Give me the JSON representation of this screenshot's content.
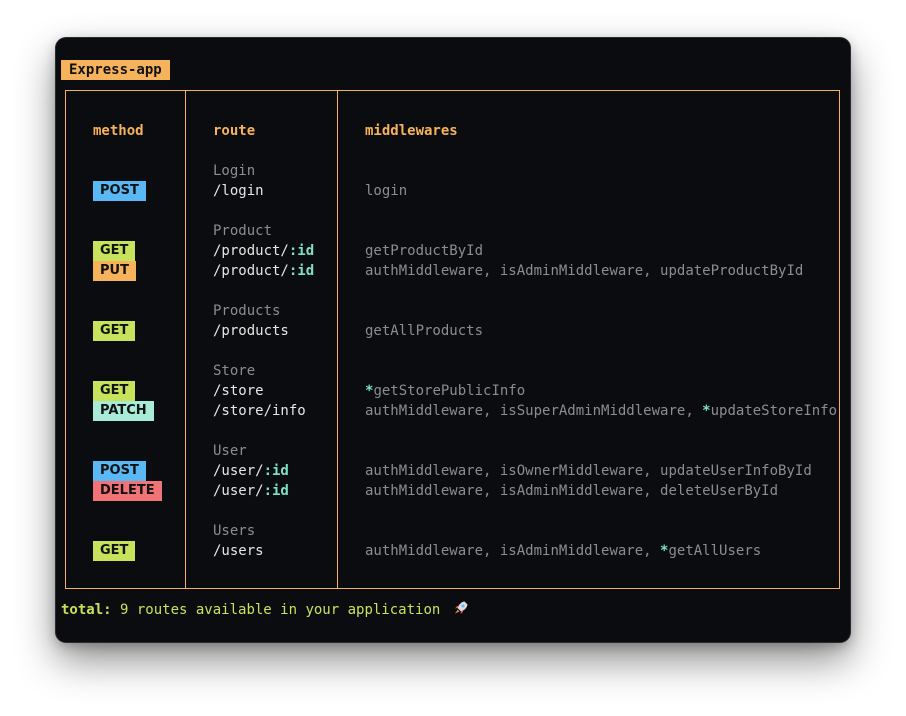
{
  "app": {
    "name": "Express-app",
    "badge_color": "#f6b35c"
  },
  "headers": {
    "method": "method",
    "route": "route",
    "middlewares": "middlewares"
  },
  "method_colors": {
    "GET": "#c7e35b",
    "POST": "#5ab8f5",
    "PUT": "#f6b35c",
    "PATCH": "#a8ecd8",
    "DELETE": "#f07378"
  },
  "groups": [
    {
      "name": "Login",
      "routes": [
        {
          "method": "POST",
          "path": "/login",
          "param": "",
          "middlewares": [
            {
              "name": "login",
              "star": false
            }
          ]
        }
      ]
    },
    {
      "name": "Product",
      "routes": [
        {
          "method": "GET",
          "path": "/product/",
          "param": ":id",
          "middlewares": [
            {
              "name": "getProductById",
              "star": false
            }
          ]
        },
        {
          "method": "PUT",
          "path": "/product/",
          "param": ":id",
          "middlewares": [
            {
              "name": "authMiddleware",
              "star": false
            },
            {
              "name": "isAdminMiddleware",
              "star": false
            },
            {
              "name": "updateProductById",
              "star": false
            }
          ]
        }
      ]
    },
    {
      "name": "Products",
      "routes": [
        {
          "method": "GET",
          "path": "/products",
          "param": "",
          "middlewares": [
            {
              "name": "getAllProducts",
              "star": false
            }
          ]
        }
      ]
    },
    {
      "name": "Store",
      "routes": [
        {
          "method": "GET",
          "path": "/store",
          "param": "",
          "middlewares": [
            {
              "name": "getStorePublicInfo",
              "star": true
            }
          ]
        },
        {
          "method": "PATCH",
          "path": "/store/info",
          "param": "",
          "middlewares": [
            {
              "name": "authMiddleware",
              "star": false
            },
            {
              "name": "isSuperAdminMiddleware",
              "star": false
            },
            {
              "name": "updateStoreInfo",
              "star": true
            }
          ]
        }
      ]
    },
    {
      "name": "User",
      "routes": [
        {
          "method": "POST",
          "path": "/user/",
          "param": ":id",
          "middlewares": [
            {
              "name": "authMiddleware",
              "star": false
            },
            {
              "name": "isOwnerMiddleware",
              "star": false
            },
            {
              "name": "updateUserInfoById",
              "star": false
            }
          ]
        },
        {
          "method": "DELETE",
          "path": "/user/",
          "param": ":id",
          "middlewares": [
            {
              "name": "authMiddleware",
              "star": false
            },
            {
              "name": "isAdminMiddleware",
              "star": false
            },
            {
              "name": "deleteUserById",
              "star": false
            }
          ]
        }
      ]
    },
    {
      "name": "Users",
      "routes": [
        {
          "method": "GET",
          "path": "/users",
          "param": "",
          "middlewares": [
            {
              "name": "authMiddleware",
              "star": false
            },
            {
              "name": "isAdminMiddleware",
              "star": false
            },
            {
              "name": "getAllUsers",
              "star": true
            }
          ]
        }
      ]
    }
  ],
  "summary": {
    "label": "total:",
    "text": "9 routes available in your application",
    "icon": "rocket-icon"
  }
}
